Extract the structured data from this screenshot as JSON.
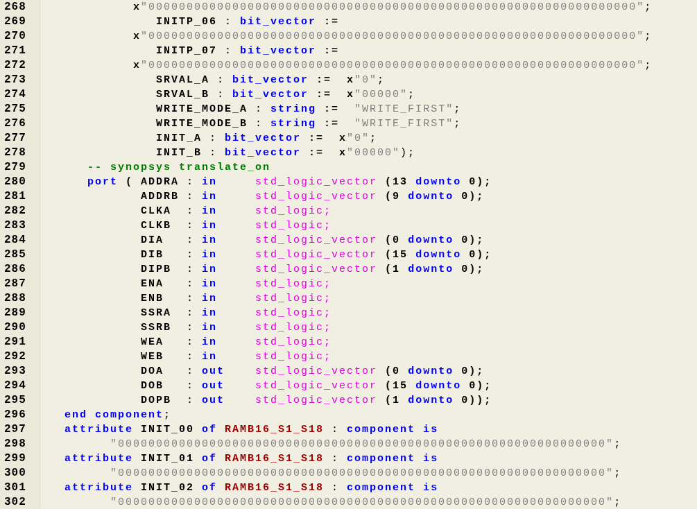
{
  "editor": {
    "lines": [
      {
        "number": "268",
        "tokens": [
          {
            "kind": "name",
            "text": "            x"
          },
          {
            "kind": "string",
            "text": "\"0000000000000000000000000000000000000000000000000000000000000000\""
          },
          {
            "kind": "punct",
            "text": ";"
          }
        ]
      },
      {
        "number": "269",
        "tokens": [
          {
            "kind": "name",
            "text": "               INITP_06"
          },
          {
            "kind": "punct",
            "text": " : "
          },
          {
            "kind": "keyword",
            "text": "bit_vector"
          },
          {
            "kind": "name",
            "text": " :="
          }
        ]
      },
      {
        "number": "270",
        "tokens": [
          {
            "kind": "name",
            "text": "            x"
          },
          {
            "kind": "string",
            "text": "\"0000000000000000000000000000000000000000000000000000000000000000\""
          },
          {
            "kind": "punct",
            "text": ";"
          }
        ]
      },
      {
        "number": "271",
        "tokens": [
          {
            "kind": "name",
            "text": "               INITP_07"
          },
          {
            "kind": "punct",
            "text": " : "
          },
          {
            "kind": "keyword",
            "text": "bit_vector"
          },
          {
            "kind": "name",
            "text": " :="
          }
        ]
      },
      {
        "number": "272",
        "tokens": [
          {
            "kind": "name",
            "text": "            x"
          },
          {
            "kind": "string",
            "text": "\"0000000000000000000000000000000000000000000000000000000000000000\""
          },
          {
            "kind": "punct",
            "text": ";"
          }
        ]
      },
      {
        "number": "273",
        "tokens": [
          {
            "kind": "name",
            "text": "               SRVAL_A"
          },
          {
            "kind": "punct",
            "text": " : "
          },
          {
            "kind": "keyword",
            "text": "bit_vector"
          },
          {
            "kind": "name",
            "text": " :=  x"
          },
          {
            "kind": "string",
            "text": "\"0\""
          },
          {
            "kind": "punct",
            "text": ";"
          }
        ]
      },
      {
        "number": "274",
        "tokens": [
          {
            "kind": "name",
            "text": "               SRVAL_B"
          },
          {
            "kind": "punct",
            "text": " : "
          },
          {
            "kind": "keyword",
            "text": "bit_vector"
          },
          {
            "kind": "name",
            "text": " :=  x"
          },
          {
            "kind": "string",
            "text": "\"00000\""
          },
          {
            "kind": "punct",
            "text": ";"
          }
        ]
      },
      {
        "number": "275",
        "tokens": [
          {
            "kind": "name",
            "text": "               WRITE_MODE_A"
          },
          {
            "kind": "punct",
            "text": " : "
          },
          {
            "kind": "keyword",
            "text": "string"
          },
          {
            "kind": "name",
            "text": " :="
          },
          {
            "kind": "string",
            "text": "  \"WRITE_FIRST\""
          },
          {
            "kind": "punct",
            "text": ";"
          }
        ]
      },
      {
        "number": "276",
        "tokens": [
          {
            "kind": "name",
            "text": "               WRITE_MODE_B"
          },
          {
            "kind": "punct",
            "text": " : "
          },
          {
            "kind": "keyword",
            "text": "string"
          },
          {
            "kind": "name",
            "text": " :="
          },
          {
            "kind": "string",
            "text": "  \"WRITE_FIRST\""
          },
          {
            "kind": "punct",
            "text": ";"
          }
        ]
      },
      {
        "number": "277",
        "tokens": [
          {
            "kind": "name",
            "text": "               INIT_A"
          },
          {
            "kind": "punct",
            "text": " : "
          },
          {
            "kind": "keyword",
            "text": "bit_vector"
          },
          {
            "kind": "name",
            "text": " :=  x"
          },
          {
            "kind": "string",
            "text": "\"0\""
          },
          {
            "kind": "punct",
            "text": ";"
          }
        ]
      },
      {
        "number": "278",
        "tokens": [
          {
            "kind": "name",
            "text": "               INIT_B"
          },
          {
            "kind": "punct",
            "text": " : "
          },
          {
            "kind": "keyword",
            "text": "bit_vector"
          },
          {
            "kind": "name",
            "text": " :=  x"
          },
          {
            "kind": "string",
            "text": "\"00000\""
          },
          {
            "kind": "punct",
            "text": ");"
          }
        ]
      },
      {
        "number": "279",
        "tokens": [
          {
            "kind": "comment",
            "text": "      -- synopsys translate_on"
          }
        ]
      },
      {
        "number": "280",
        "tokens": [
          {
            "kind": "keyword",
            "text": "      port"
          },
          {
            "kind": "name",
            "text": " ( ADDRA"
          },
          {
            "kind": "punct",
            "text": " : "
          },
          {
            "kind": "keyword",
            "text": "in"
          },
          {
            "kind": "type",
            "text": "     std_logic_vector"
          },
          {
            "kind": "name",
            "text": " (13 "
          },
          {
            "kind": "keyword",
            "text": "downto"
          },
          {
            "kind": "name",
            "text": " 0);"
          }
        ]
      },
      {
        "number": "281",
        "tokens": [
          {
            "kind": "name",
            "text": "             ADDRB"
          },
          {
            "kind": "punct",
            "text": " : "
          },
          {
            "kind": "keyword",
            "text": "in"
          },
          {
            "kind": "type",
            "text": "     std_logic_vector"
          },
          {
            "kind": "name",
            "text": " (9 "
          },
          {
            "kind": "keyword",
            "text": "downto"
          },
          {
            "kind": "name",
            "text": " 0);"
          }
        ]
      },
      {
        "number": "282",
        "tokens": [
          {
            "kind": "name",
            "text": "             CLKA"
          },
          {
            "kind": "punct",
            "text": "  : "
          },
          {
            "kind": "keyword",
            "text": "in"
          },
          {
            "kind": "type",
            "text": "     std_logic;"
          }
        ]
      },
      {
        "number": "283",
        "tokens": [
          {
            "kind": "name",
            "text": "             CLKB"
          },
          {
            "kind": "punct",
            "text": "  : "
          },
          {
            "kind": "keyword",
            "text": "in"
          },
          {
            "kind": "type",
            "text": "     std_logic;"
          }
        ]
      },
      {
        "number": "284",
        "tokens": [
          {
            "kind": "name",
            "text": "             DIA"
          },
          {
            "kind": "punct",
            "text": "   : "
          },
          {
            "kind": "keyword",
            "text": "in"
          },
          {
            "kind": "type",
            "text": "     std_logic_vector"
          },
          {
            "kind": "name",
            "text": " (0 "
          },
          {
            "kind": "keyword",
            "text": "downto"
          },
          {
            "kind": "name",
            "text": " 0);"
          }
        ]
      },
      {
        "number": "285",
        "tokens": [
          {
            "kind": "name",
            "text": "             DIB"
          },
          {
            "kind": "punct",
            "text": "   : "
          },
          {
            "kind": "keyword",
            "text": "in"
          },
          {
            "kind": "type",
            "text": "     std_logic_vector"
          },
          {
            "kind": "name",
            "text": " (15 "
          },
          {
            "kind": "keyword",
            "text": "downto"
          },
          {
            "kind": "name",
            "text": " 0);"
          }
        ]
      },
      {
        "number": "286",
        "tokens": [
          {
            "kind": "name",
            "text": "             DIPB"
          },
          {
            "kind": "punct",
            "text": "  : "
          },
          {
            "kind": "keyword",
            "text": "in"
          },
          {
            "kind": "type",
            "text": "     std_logic_vector"
          },
          {
            "kind": "name",
            "text": " (1 "
          },
          {
            "kind": "keyword",
            "text": "downto"
          },
          {
            "kind": "name",
            "text": " 0);"
          }
        ]
      },
      {
        "number": "287",
        "tokens": [
          {
            "kind": "name",
            "text": "             ENA"
          },
          {
            "kind": "punct",
            "text": "   : "
          },
          {
            "kind": "keyword",
            "text": "in"
          },
          {
            "kind": "type",
            "text": "     std_logic;"
          }
        ]
      },
      {
        "number": "288",
        "tokens": [
          {
            "kind": "name",
            "text": "             ENB"
          },
          {
            "kind": "punct",
            "text": "   : "
          },
          {
            "kind": "keyword",
            "text": "in"
          },
          {
            "kind": "type",
            "text": "     std_logic;"
          }
        ]
      },
      {
        "number": "289",
        "tokens": [
          {
            "kind": "name",
            "text": "             SSRA"
          },
          {
            "kind": "punct",
            "text": "  : "
          },
          {
            "kind": "keyword",
            "text": "in"
          },
          {
            "kind": "type",
            "text": "     std_logic;"
          }
        ]
      },
      {
        "number": "290",
        "tokens": [
          {
            "kind": "name",
            "text": "             SSRB"
          },
          {
            "kind": "punct",
            "text": "  : "
          },
          {
            "kind": "keyword",
            "text": "in"
          },
          {
            "kind": "type",
            "text": "     std_logic;"
          }
        ]
      },
      {
        "number": "291",
        "tokens": [
          {
            "kind": "name",
            "text": "             WEA"
          },
          {
            "kind": "punct",
            "text": "   : "
          },
          {
            "kind": "keyword",
            "text": "in"
          },
          {
            "kind": "type",
            "text": "     std_logic;"
          }
        ]
      },
      {
        "number": "292",
        "tokens": [
          {
            "kind": "name",
            "text": "             WEB"
          },
          {
            "kind": "punct",
            "text": "   : "
          },
          {
            "kind": "keyword",
            "text": "in"
          },
          {
            "kind": "type",
            "text": "     std_logic;"
          }
        ]
      },
      {
        "number": "293",
        "tokens": [
          {
            "kind": "name",
            "text": "             DOA"
          },
          {
            "kind": "punct",
            "text": "   : "
          },
          {
            "kind": "keyword",
            "text": "out"
          },
          {
            "kind": "type",
            "text": "    std_logic_vector"
          },
          {
            "kind": "name",
            "text": " (0 "
          },
          {
            "kind": "keyword",
            "text": "downto"
          },
          {
            "kind": "name",
            "text": " 0);"
          }
        ]
      },
      {
        "number": "294",
        "tokens": [
          {
            "kind": "name",
            "text": "             DOB"
          },
          {
            "kind": "punct",
            "text": "   : "
          },
          {
            "kind": "keyword",
            "text": "out"
          },
          {
            "kind": "type",
            "text": "    std_logic_vector"
          },
          {
            "kind": "name",
            "text": " (15 "
          },
          {
            "kind": "keyword",
            "text": "downto"
          },
          {
            "kind": "name",
            "text": " 0);"
          }
        ]
      },
      {
        "number": "295",
        "tokens": [
          {
            "kind": "name",
            "text": "             DOPB"
          },
          {
            "kind": "punct",
            "text": "  : "
          },
          {
            "kind": "keyword",
            "text": "out"
          },
          {
            "kind": "type",
            "text": "    std_logic_vector"
          },
          {
            "kind": "name",
            "text": " (1 "
          },
          {
            "kind": "keyword",
            "text": "downto"
          },
          {
            "kind": "name",
            "text": " 0));"
          }
        ]
      },
      {
        "number": "296",
        "tokens": [
          {
            "kind": "keyword",
            "text": "   end component"
          },
          {
            "kind": "punct",
            "text": ";"
          }
        ]
      },
      {
        "number": "297",
        "tokens": [
          {
            "kind": "keyword",
            "text": "   attribute"
          },
          {
            "kind": "name",
            "text": " INIT_00 "
          },
          {
            "kind": "keyword",
            "text": "of"
          },
          {
            "kind": "entity",
            "text": " RAMB16_S1_S18"
          },
          {
            "kind": "punct",
            "text": " : "
          },
          {
            "kind": "keyword",
            "text": "component is"
          }
        ]
      },
      {
        "number": "298",
        "tokens": [
          {
            "kind": "string",
            "text": "         \"0000000000000000000000000000000000000000000000000000000000000000\""
          },
          {
            "kind": "punct",
            "text": ";"
          }
        ]
      },
      {
        "number": "299",
        "tokens": [
          {
            "kind": "keyword",
            "text": "   attribute"
          },
          {
            "kind": "name",
            "text": " INIT_01 "
          },
          {
            "kind": "keyword",
            "text": "of"
          },
          {
            "kind": "entity",
            "text": " RAMB16_S1_S18"
          },
          {
            "kind": "punct",
            "text": " : "
          },
          {
            "kind": "keyword",
            "text": "component is"
          }
        ]
      },
      {
        "number": "300",
        "tokens": [
          {
            "kind": "string",
            "text": "         \"0000000000000000000000000000000000000000000000000000000000000000\""
          },
          {
            "kind": "punct",
            "text": ";"
          }
        ]
      },
      {
        "number": "301",
        "tokens": [
          {
            "kind": "keyword",
            "text": "   attribute"
          },
          {
            "kind": "name",
            "text": " INIT_02 "
          },
          {
            "kind": "keyword",
            "text": "of"
          },
          {
            "kind": "entity",
            "text": " RAMB16_S1_S18"
          },
          {
            "kind": "punct",
            "text": " : "
          },
          {
            "kind": "keyword",
            "text": "component is"
          }
        ]
      },
      {
        "number": "302",
        "tokens": [
          {
            "kind": "string",
            "text": "         \"0000000000000000000000000000000000000000000000000000000000000000\""
          },
          {
            "kind": "punct",
            "text": ";"
          }
        ]
      }
    ]
  }
}
